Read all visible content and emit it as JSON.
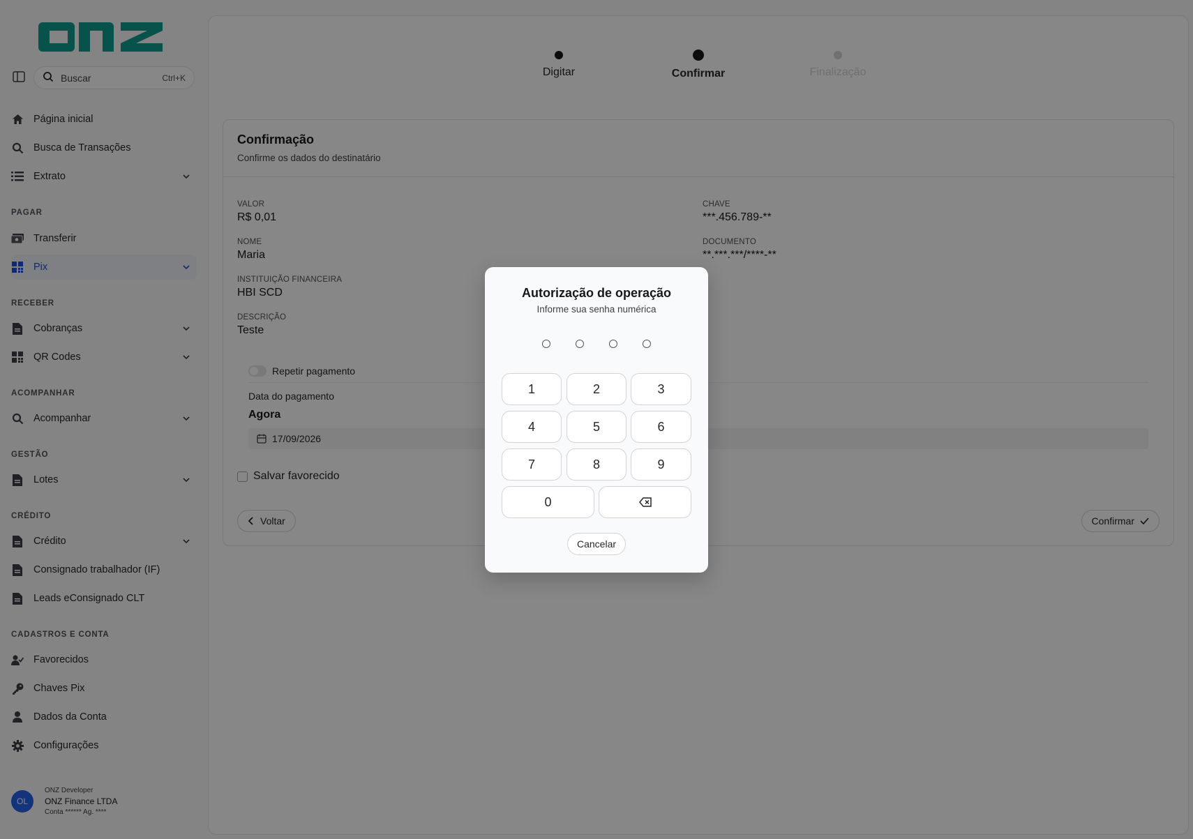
{
  "brand": {
    "logo_text": "onz",
    "color": "#0d9488"
  },
  "sidebar": {
    "search": {
      "placeholder": "Buscar",
      "shortcut": "Ctrl+K"
    },
    "items": [
      {
        "label": "Página inicial",
        "icon": "home-icon"
      },
      {
        "label": "Busca de Transações",
        "icon": "search-icon"
      },
      {
        "label": "Extrato",
        "icon": "list-icon",
        "expandable": true
      }
    ],
    "sections": {
      "pagar": {
        "title": "PAGAR",
        "items": [
          {
            "label": "Transferir",
            "icon": "money-icon"
          },
          {
            "label": "Pix",
            "icon": "pix-grid-icon",
            "active": true,
            "expandable": true
          }
        ]
      },
      "receber": {
        "title": "RECEBER",
        "items": [
          {
            "label": "Cobranças",
            "icon": "document-icon",
            "expandable": true
          },
          {
            "label": "QR Codes",
            "icon": "qr-icon",
            "expandable": true
          }
        ]
      },
      "acompanhar": {
        "title": "ACOMPANHAR",
        "items": [
          {
            "label": "Acompanhar",
            "icon": "search-icon",
            "expandable": true
          }
        ]
      },
      "gestao": {
        "title": "GESTÃO",
        "items": [
          {
            "label": "Lotes",
            "icon": "document-icon",
            "expandable": true
          }
        ]
      },
      "credito": {
        "title": "CRÉDITO",
        "items": [
          {
            "label": "Crédito",
            "icon": "document-icon",
            "expandable": true
          },
          {
            "label": "Consignado trabalhador (IF)",
            "icon": "document-icon"
          },
          {
            "label": "Leads eConsignado CLT",
            "icon": "document-icon"
          }
        ]
      },
      "cadastros": {
        "title": "CADASTROS E CONTA",
        "items": [
          {
            "label": "Favorecidos",
            "icon": "user-check-icon"
          },
          {
            "label": "Chaves Pix",
            "icon": "key-icon"
          },
          {
            "label": "Dados da Conta",
            "icon": "user-icon"
          },
          {
            "label": "Configurações",
            "icon": "gear-icon"
          }
        ]
      }
    },
    "user": {
      "initials": "OL",
      "role": "ONZ Developer",
      "company": "ONZ Finance LTDA",
      "account": "Conta ****** Ag. ****"
    }
  },
  "stepper": {
    "steps": [
      "Digitar",
      "Confirmar",
      "Finalização"
    ],
    "current": 1
  },
  "confirmation": {
    "title": "Confirmação",
    "subtitle": "Confirme os dados do destinatário",
    "fields": {
      "valor": {
        "label": "VALOR",
        "value": "R$ 0,01"
      },
      "nome": {
        "label": "NOME",
        "value": "Maria"
      },
      "instituicao": {
        "label": "INSTITUIÇÃO FINANCEIRA",
        "value": "HBI SCD"
      },
      "descricao": {
        "label": "DESCRIÇÃO",
        "value": "Teste"
      },
      "chave": {
        "label": "CHAVE",
        "value": "***.456.789-**"
      },
      "documento": {
        "label": "DOCUMENTO",
        "value": "**.***.***/****-**"
      }
    },
    "repeat_label": "Repetir pagamento",
    "payment_date_label": "Data do pagamento",
    "payment_date_value": "Agora",
    "date": "17/09/2026",
    "save_favorite_label": "Salvar favorecido",
    "back_label": "Voltar",
    "confirm_label": "Confirmar"
  },
  "modal": {
    "title": "Autorização de operação",
    "subtitle": "Informe sua senha numérica",
    "pin_length": 4,
    "keys": [
      "1",
      "2",
      "3",
      "4",
      "5",
      "6",
      "7",
      "8",
      "9",
      "0"
    ],
    "backspace_icon": "backspace-icon",
    "cancel_label": "Cancelar"
  }
}
